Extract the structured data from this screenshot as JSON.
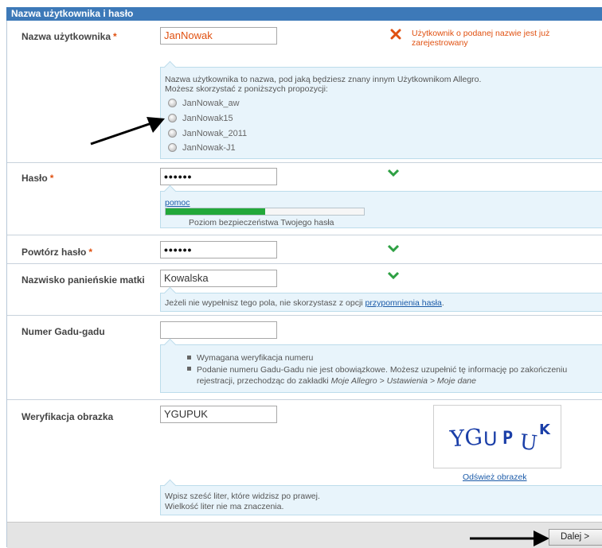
{
  "section": {
    "title": "Nazwa użytkownika i hasło"
  },
  "username": {
    "label": "Nazwa użytkownika",
    "required": "*",
    "value": "JanNowak",
    "error_line1": "Użytkownik o podanej nazwie jest już",
    "error_line2": "zarejestrowany",
    "hint_line1": "Nazwa użytkownika to nazwa, pod jaką będziesz znany innym Użytkownikom Allegro.",
    "hint_line2": "Możesz skorzystać z poniższych propozycji:",
    "suggestions": [
      "JanNowak_aw",
      "JanNowak15",
      "JanNowak_2011",
      "JanNowak-J1"
    ]
  },
  "password": {
    "label": "Hasło",
    "required": "*",
    "value": "••••••",
    "help_link": "pomoc",
    "strength_label": "Poziom bezpieczeństwa Twojego hasła",
    "strength": 0.5
  },
  "repeat_password": {
    "label": "Powtórz hasło",
    "required": "*",
    "value": "••••••"
  },
  "maiden_name": {
    "label": "Nazwisko panieńskie matki",
    "value": "Kowalska",
    "hint_before": "Jeżeli nie wypełnisz tego pola, nie skorzystasz z opcji ",
    "hint_link": "przypomnienia hasła",
    "hint_after": "."
  },
  "gadu": {
    "label": "Numer Gadu-gadu",
    "value": "",
    "bullet1": "Wymagana weryfikacja numeru",
    "bullet2_line1": "Podanie numeru Gadu-Gadu nie jest obowiązkowe. Możesz uzupełnić tę informację po zakończeniu",
    "bullet2_line2_plain": "rejestracji, przechodząc do zakładki ",
    "bullet2_line2_italic": "Moje Allegro > Ustawienia > Moje dane"
  },
  "captcha": {
    "label": "Weryfikacja obrazka",
    "value": "YGUPUK",
    "image_text": "YGUPUK",
    "refresh_link": "Odśwież obrazek",
    "hint_line1": "Wpisz sześć liter, które widzisz po prawej.",
    "hint_line2": "Wielkość liter nie ma znaczenia."
  },
  "footer": {
    "next_button": "Dalej >"
  },
  "colors": {
    "header": "#3d79b8",
    "error": "#e05010",
    "ok": "#2ea043",
    "hint_bg": "#e8f4fb",
    "strength": "#22a83a"
  }
}
